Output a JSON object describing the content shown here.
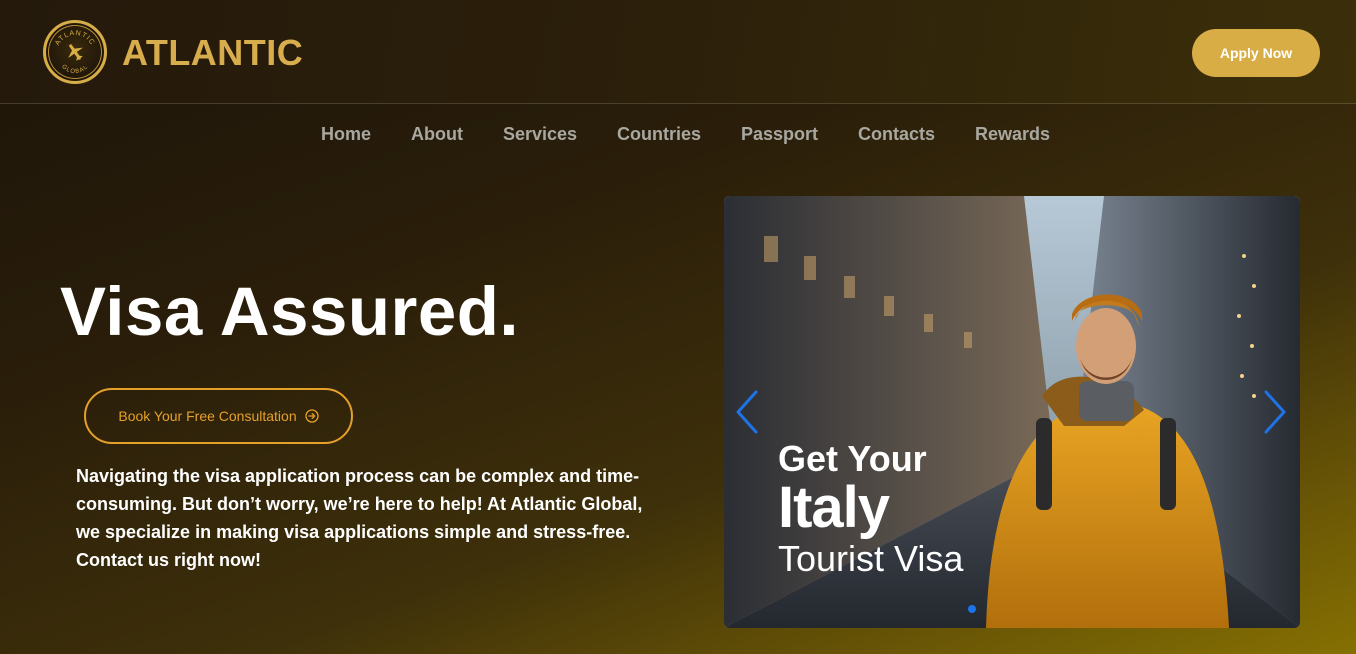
{
  "brand": {
    "name": "ATLANTIC",
    "logo_text": "ATLANTIC GLOBAL",
    "logo_icon": "airplane-icon"
  },
  "header": {
    "apply_label": "Apply Now"
  },
  "nav": {
    "items": [
      "Home",
      "About",
      "Services",
      "Countries",
      "Passport",
      "Contacts",
      "Rewards"
    ]
  },
  "hero": {
    "title": "Visa Assured.",
    "cta_label": "Book Your Free Consultation",
    "cta_icon": "arrow-right-circle-icon",
    "description": "Navigating the visa application process can be complex and time-consuming. But don’t worry, we’re here to help! At Atlantic Global, we specialize in making visa applications simple and stress-free. Contact us right now!"
  },
  "carousel": {
    "slide_line1": "Get Your",
    "slide_line2": "Italy",
    "slide_line3": "Tourist Visa",
    "prev_icon": "chevron-left-icon",
    "next_icon": "chevron-right-icon",
    "active_index": 0
  },
  "colors": {
    "accent": "#d9ad46",
    "cta_outline": "#e5a02a",
    "carousel_control": "#1e73e8"
  }
}
